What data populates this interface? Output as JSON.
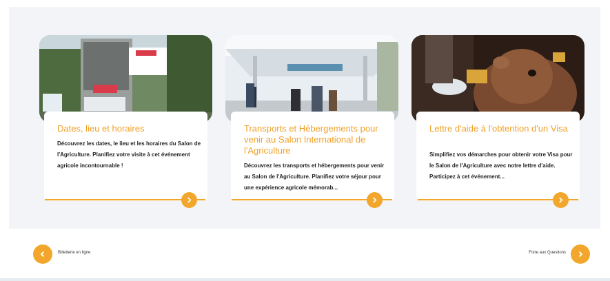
{
  "accent_color": "#f2a72c",
  "title_color": "#f0a12a",
  "cards": [
    {
      "title": "Dates, lieu et horaires",
      "description": "Découvrez les dates, le lieu et les horaires du Salon de l'Agriculture. Planifiez votre visite à cet événement agricole incontournable !",
      "arrow_icon": "chevron-right-icon"
    },
    {
      "title": "Transports et Hébergements pour venir au Salon International de l'Agriculture",
      "description": "Découvrez les transports et hébergements pour venir au Salon de l'Agriculture. Planifiez votre séjour pour une expérience agricole mémorab...",
      "arrow_icon": "chevron-right-icon"
    },
    {
      "title": "Lettre d'aide à l'obtention d'un Visa",
      "description": "Simplifiez vos démarches pour obtenir votre Visa pour le Salon de l'Agriculture avec notre lettre d'aide. Participez à cet événement...",
      "arrow_icon": "chevron-right-icon"
    }
  ],
  "nav": {
    "prev_label": "Billetterie en ligne",
    "next_label": "Foire aux Questions",
    "prev_icon": "chevron-left-icon",
    "next_icon": "chevron-right-icon"
  }
}
